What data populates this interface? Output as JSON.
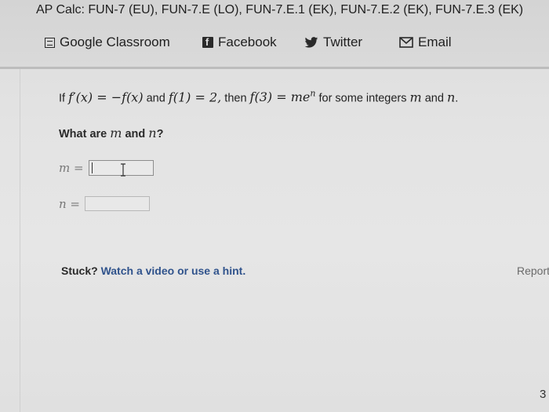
{
  "header": {
    "title": "AP Calc: FUN-7 (EU), FUN-7.E (LO), FUN-7.E.1 (EK), FUN-7.E.2 (EK), FUN-7.E.3 (EK)"
  },
  "share": {
    "google_classroom": "Google Classroom",
    "facebook": "Facebook",
    "twitter": "Twitter",
    "email": "Email"
  },
  "question": {
    "part1": "If ",
    "expr1": "f′(x) = −f(x)",
    "part2": " and ",
    "expr2": "f(1) = 2,",
    "part3": " then ",
    "expr3": "f(3) = me",
    "expr3_sup": "n",
    "part4": " for some integers ",
    "var_m": "m",
    "part5": " and ",
    "var_n": "n",
    "part6": "."
  },
  "prompt": {
    "text": "What are ",
    "m": "m",
    "and": " and ",
    "n": "n",
    "q": "?"
  },
  "answers": {
    "m_label": "m =",
    "n_label": "n =",
    "m_value": "",
    "n_value": ""
  },
  "help": {
    "stuck": "Stuck?",
    "link": "Watch a video or use a hint."
  },
  "report": "Report",
  "page_number": "3"
}
